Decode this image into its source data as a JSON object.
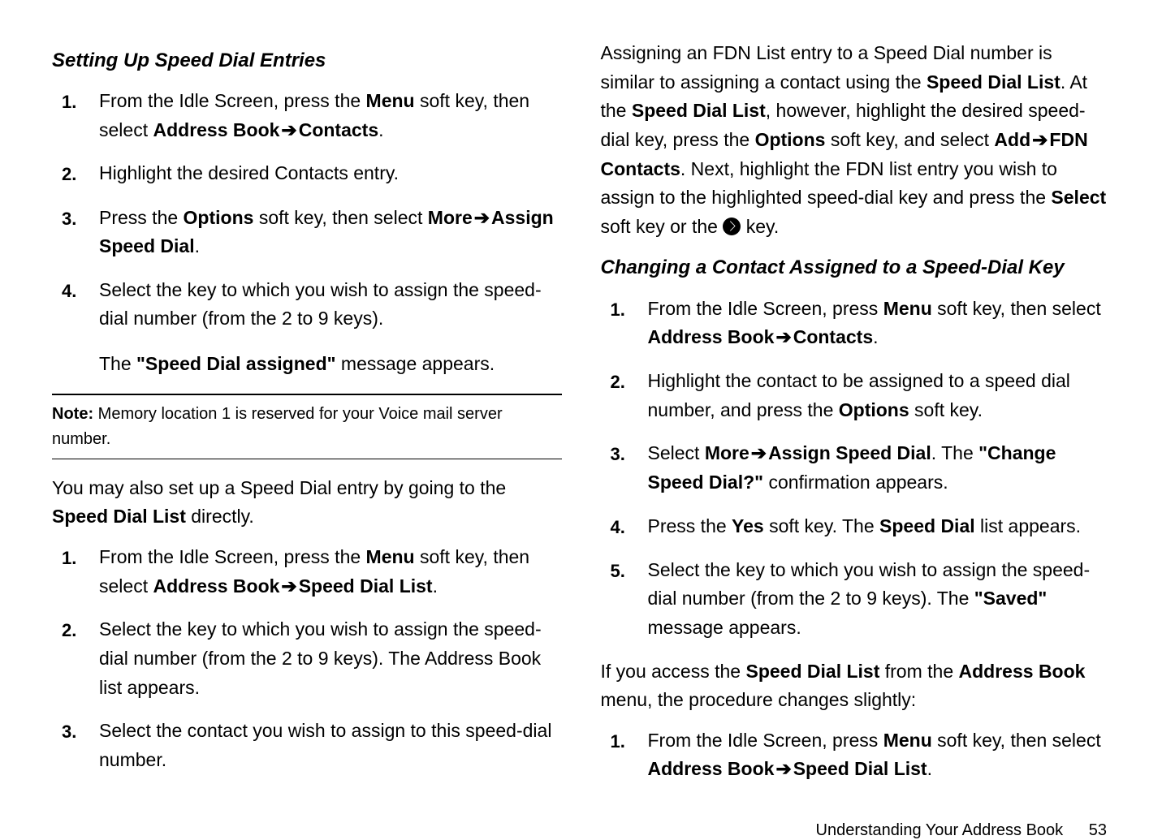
{
  "left": {
    "heading1": "Setting Up Speed Dial Entries",
    "steps1": [
      {
        "num": "1.",
        "pre": "From the Idle Screen, press the ",
        "b1": "Menu",
        "mid1": " soft key, then select ",
        "b2": "Address Book",
        "arrow": " ➔ ",
        "b3": "Contacts",
        "post": "."
      },
      {
        "num": "2.",
        "plain": "Highlight the desired Contacts entry."
      },
      {
        "num": "3.",
        "pre": "Press the ",
        "b1": "Options",
        "mid1": " soft key, then select ",
        "b2": "More",
        "arrow": " ➔ ",
        "b3": "Assign Speed Dial",
        "post": "."
      },
      {
        "num": "4.",
        "plain": "Select the key to which you wish to assign the speed-dial number (from the 2 to 9 keys).",
        "sub_pre": "The ",
        "sub_b": "\"Speed Dial assigned\"",
        "sub_post": " message appears."
      }
    ],
    "note_label": "Note:",
    "note_text": " Memory location 1 is reserved for your Voice mail server number.",
    "para_pre": "You may also set up a Speed Dial entry by going to the ",
    "para_b": "Speed Dial List",
    "para_post": " directly.",
    "steps2": [
      {
        "num": "1.",
        "pre": "From the Idle Screen, press the ",
        "b1": "Menu",
        "mid1": " soft key, then select ",
        "b2": "Address Book",
        "arrow": " ➔ ",
        "b3": "Speed Dial List",
        "post": "."
      },
      {
        "num": "2.",
        "plain": "Select the key to which you wish to assign the speed-dial number (from the 2 to 9 keys). The Address Book list appears."
      },
      {
        "num": "3.",
        "plain": "Select the contact you wish to assign to this speed-dial number."
      }
    ]
  },
  "right": {
    "intro_p1": "Assigning an FDN List entry to a Speed Dial number is similar to assigning a contact using the ",
    "intro_b1": "Speed Dial List",
    "intro_p2": ". At the ",
    "intro_b2": "Speed Dial List",
    "intro_p3": ", however, highlight the desired speed-dial key, press the ",
    "intro_b3": "Options",
    "intro_p4": " soft key, and select ",
    "intro_b4": "Add",
    "intro_arrow": " ➔ ",
    "intro_b5": "FDN Contacts",
    "intro_p5": ". Next, highlight the FDN list entry you wish to assign to the highlighted speed-dial key and press the ",
    "intro_b6": "Select",
    "intro_p6": " soft key or the ",
    "intro_p7": " key.",
    "heading2": "Changing a Contact Assigned to a Speed-Dial Key",
    "steps3": [
      {
        "num": "1.",
        "pre": "From the Idle Screen, press ",
        "b1": "Menu",
        "mid1": " soft key, then select ",
        "b2": "Address Book",
        "arrow": " ➔ ",
        "b3": "Contacts",
        "post": "."
      },
      {
        "num": "2.",
        "pre": "Highlight the contact to be assigned to a speed dial number, and press the ",
        "b1": "Options",
        "post": " soft key."
      },
      {
        "num": "3.",
        "pre": "Select ",
        "b1": "More",
        "arrow": " ➔ ",
        "b2": "Assign Speed Dial",
        "mid1": ". The ",
        "b3": "\"Change Speed Dial?\"",
        "post": " confirmation appears."
      },
      {
        "num": "4.",
        "pre": "Press the ",
        "b1": "Yes",
        "mid1": " soft key. The ",
        "b2": "Speed Dial",
        "post": " list appears."
      },
      {
        "num": "5.",
        "pre": "Select the key to which you wish to assign the speed-dial number (from the 2 to 9 keys). The ",
        "b1": "\"Saved\"",
        "post": " message appears."
      }
    ],
    "para2_pre": "If you access the ",
    "para2_b1": "Speed Dial List",
    "para2_mid": " from the ",
    "para2_b2": "Address Book",
    "para2_post": " menu, the procedure changes slightly:",
    "steps4": [
      {
        "num": "1.",
        "pre": "From the Idle Screen, press ",
        "b1": "Menu",
        "mid1": " soft key, then select ",
        "b2": "Address Book",
        "arrow": " ➔ ",
        "b3": "Speed Dial List",
        "post": "."
      }
    ]
  },
  "footer": {
    "section": "Understanding Your Address Book",
    "page": "53"
  }
}
